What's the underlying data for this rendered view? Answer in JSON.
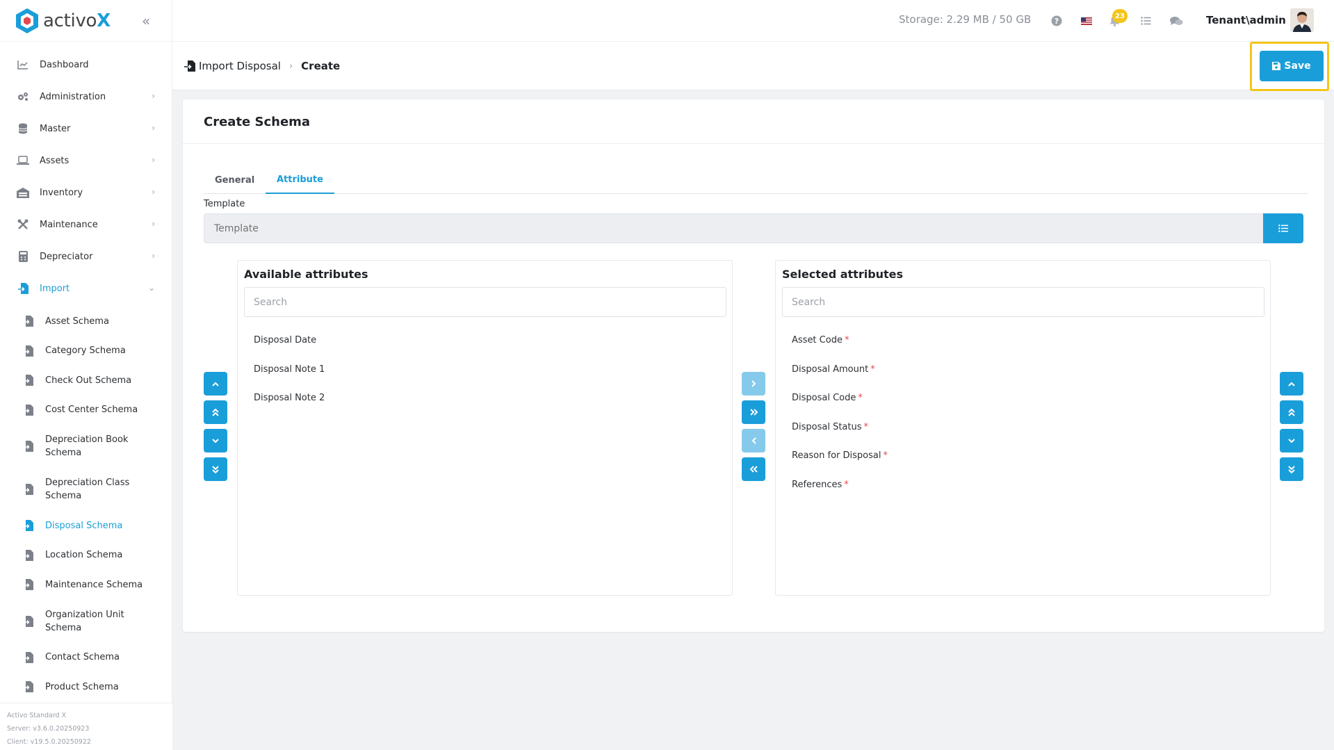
{
  "brand": {
    "name": "activo",
    "suffix": "X"
  },
  "sidebar": {
    "items": [
      {
        "label": "Dashboard",
        "icon": "chart-line-icon",
        "has_children": false
      },
      {
        "label": "Administration",
        "icon": "cogs-icon",
        "has_children": true
      },
      {
        "label": "Master",
        "icon": "database-icon",
        "has_children": true
      },
      {
        "label": "Assets",
        "icon": "laptop-icon",
        "has_children": true
      },
      {
        "label": "Inventory",
        "icon": "warehouse-icon",
        "has_children": true
      },
      {
        "label": "Maintenance",
        "icon": "tools-icon",
        "has_children": true
      },
      {
        "label": "Depreciator",
        "icon": "calculator-icon",
        "has_children": true
      },
      {
        "label": "Import",
        "icon": "file-import-icon",
        "has_children": true,
        "expanded": true
      }
    ],
    "import_children": [
      {
        "label": "Asset Schema"
      },
      {
        "label": "Category Schema"
      },
      {
        "label": "Check Out Schema"
      },
      {
        "label": "Cost Center Schema"
      },
      {
        "label": "Depreciation Book Schema"
      },
      {
        "label": "Depreciation Class Schema"
      },
      {
        "label": "Disposal Schema",
        "active": true
      },
      {
        "label": "Location Schema"
      },
      {
        "label": "Maintenance Schema"
      },
      {
        "label": "Organization Unit Schema"
      },
      {
        "label": "Contact Schema"
      },
      {
        "label": "Product Schema"
      }
    ],
    "version": {
      "product": "Activo Standard X",
      "server": "Server: v3.6.0.20250923",
      "client": "Client: v19.5.0.20250922"
    }
  },
  "topbar": {
    "storage": "Storage: 2.29 MB / 50 GB",
    "notification_count": "23",
    "user": "Tenant\\admin"
  },
  "breadcrumb": {
    "parent": "Import Disposal",
    "current": "Create"
  },
  "toolbar": {
    "save_label": "Save"
  },
  "form": {
    "title": "Create Schema",
    "tabs": [
      {
        "label": "General",
        "active": false
      },
      {
        "label": "Attribute",
        "active": true
      }
    ],
    "template": {
      "label": "Template",
      "placeholder": "Template",
      "value": ""
    }
  },
  "available": {
    "title": "Available attributes",
    "search_placeholder": "Search",
    "items": [
      "Disposal Date",
      "Disposal Note 1",
      "Disposal Note 2"
    ]
  },
  "selected": {
    "title": "Selected attributes",
    "search_placeholder": "Search",
    "items": [
      {
        "label": "Asset Code",
        "required": true
      },
      {
        "label": "Disposal Amount",
        "required": true
      },
      {
        "label": "Disposal Code",
        "required": true
      },
      {
        "label": "Disposal Status",
        "required": true
      },
      {
        "label": "Reason for Disposal",
        "required": true
      },
      {
        "label": "References",
        "required": true
      }
    ],
    "required_mark": "*"
  },
  "colors": {
    "accent": "#1a9ed9",
    "highlight": "#f5c518",
    "required": "#e5484d"
  }
}
